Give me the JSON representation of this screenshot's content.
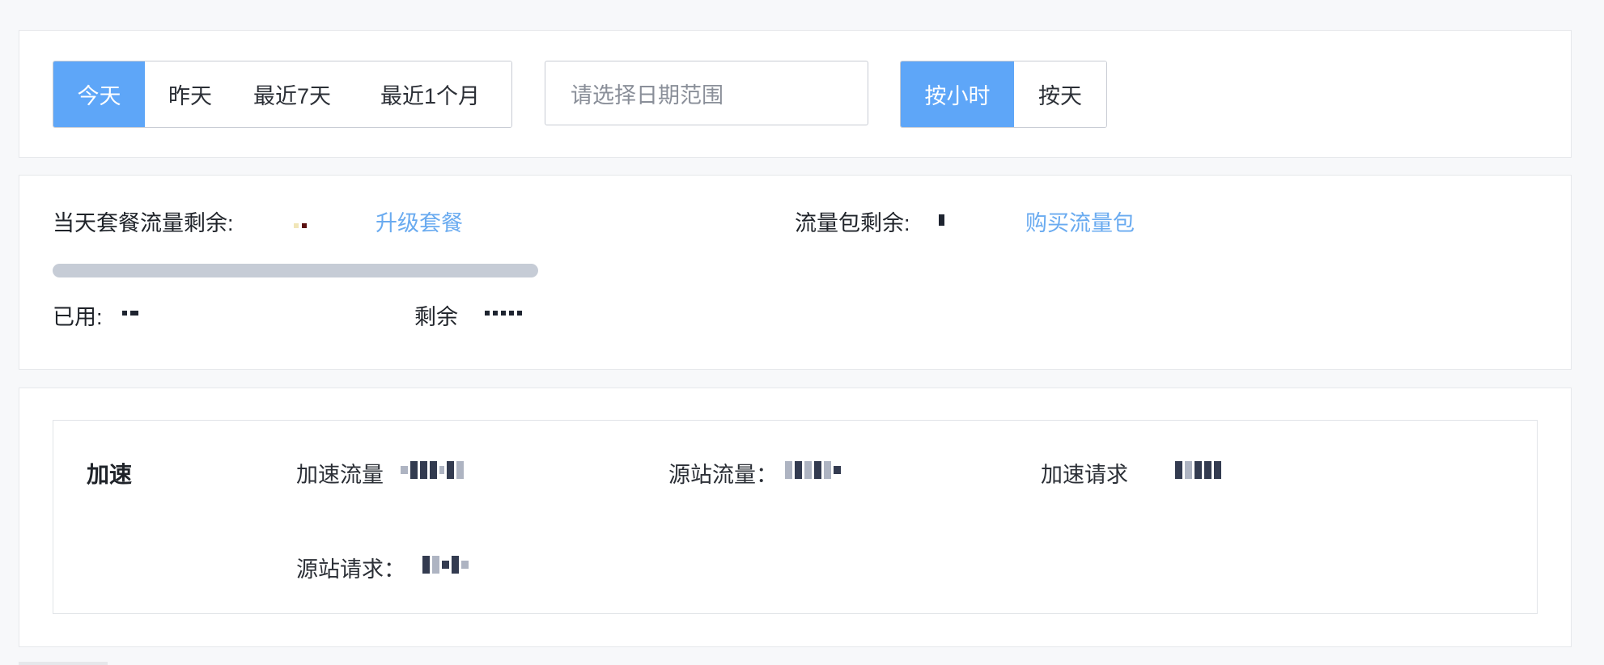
{
  "filters": {
    "range_options": [
      "今天",
      "昨天",
      "最近7天",
      "最近1个月"
    ],
    "range_selected": "今天",
    "date_range_placeholder": "请选择日期范围",
    "granularity_options": [
      "按小时",
      "按天"
    ],
    "granularity_selected": "按小时"
  },
  "quota": {
    "daily_remaining_label": "当天套餐流量剩余:",
    "upgrade_link": "升级套餐",
    "package_remaining_label": "流量包剩余:",
    "buy_package_link": "购买流量包",
    "used_label": "已用:",
    "remaining_label": "剩余",
    "usage_fraction": 0
  },
  "stats": {
    "section_title": "加速",
    "accel_traffic_label": "加速流量",
    "origin_traffic_label": "源站流量：",
    "accel_requests_label": "加速请求",
    "origin_requests_label": "源站请求："
  },
  "colors": {
    "accent": "#5ea6f8",
    "link": "#6aabf0",
    "progress_track": "#c6ccd6"
  }
}
